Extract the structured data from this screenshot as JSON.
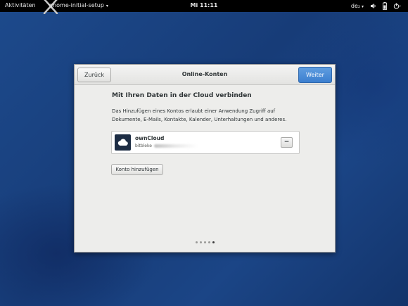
{
  "topbar": {
    "activities": "Aktivitäten",
    "app_menu": "gnome-initial-setup",
    "clock": "Mi 11:11",
    "keyboard": "de₂",
    "icons": [
      "volume-icon",
      "battery-icon",
      "power-icon"
    ]
  },
  "dialog": {
    "title": "Online-Konten",
    "back_label": "Zurück",
    "next_label": "Weiter",
    "heading": "Mit Ihren Daten in der Cloud verbinden",
    "description": "Das Hinzufügen eines Kontos erlaubt einer Anwendung Zugriff auf Dokumente, E-Mails, Kontakte, Kalender, Unterhaltungen und anderes.",
    "accounts": [
      {
        "name": "ownCloud",
        "user": "bitbleke",
        "icon": "owncloud-icon"
      }
    ],
    "remove_label": "−",
    "add_account_label": "Konto hinzufügen",
    "pages": {
      "total": 5,
      "current": 5
    }
  },
  "colors": {
    "accent": "#3c7fcf",
    "desktop": "#1a3f7e"
  }
}
